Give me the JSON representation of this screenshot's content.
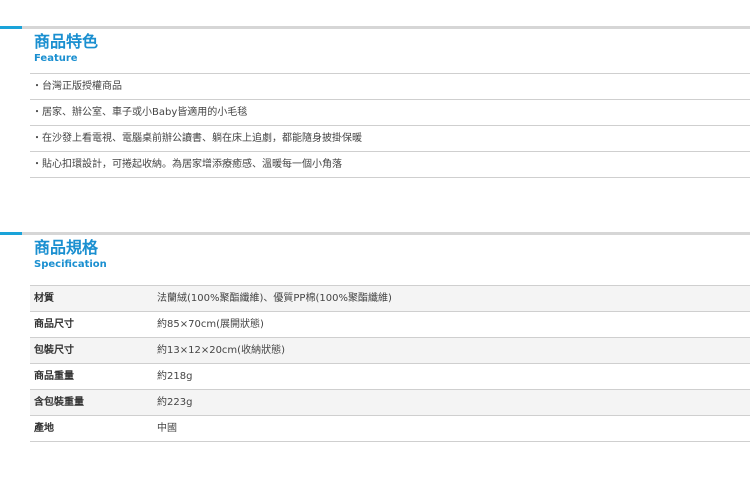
{
  "feature": {
    "title": "商品特色",
    "subtitle": "Feature",
    "bullet": "・",
    "items": [
      "台灣正版授權商品",
      "居家、辦公室、車子或小Baby皆適用的小毛毯",
      "在沙發上看電視、電腦桌前辦公讀書、躺在床上追劇，都能隨身披掛保暖",
      "貼心扣環設計，可捲起收納。為居家增添療癒感、溫暖每一個小角落"
    ]
  },
  "specification": {
    "title": "商品規格",
    "subtitle": "Specification",
    "rows": [
      {
        "label": "材質",
        "value": "法蘭絨(100%聚酯纖維)、優質PP棉(100%聚酯纖維)"
      },
      {
        "label": "商品尺寸",
        "value": "約85×70cm(展開狀態)"
      },
      {
        "label": "包裝尺寸",
        "value": "約13×12×20cm(收納狀態)"
      },
      {
        "label": "商品重量",
        "value": "約218g"
      },
      {
        "label": "含包裝重量",
        "value": "約223g"
      },
      {
        "label": "產地",
        "value": "中國"
      }
    ]
  },
  "colors": {
    "accent": "#1a8fd0",
    "rule": "#d6d6d6",
    "row_shade": "#f4f4f4"
  }
}
